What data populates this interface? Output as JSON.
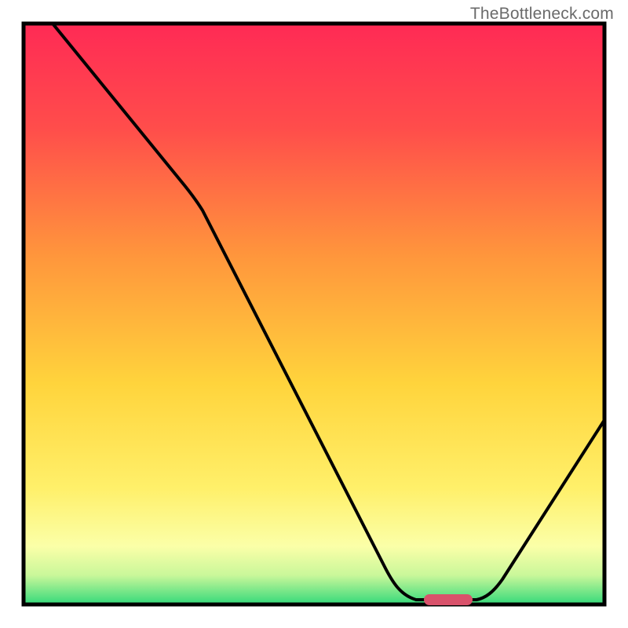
{
  "watermark": "TheBottleneck.com",
  "chart_data": {
    "type": "line",
    "title": "",
    "xlabel": "",
    "ylabel": "",
    "xlim": [
      0,
      100
    ],
    "ylim": [
      0,
      100
    ],
    "grid": false,
    "legend": false,
    "annotations": [],
    "gradient_colors": {
      "top": "#ff2a55",
      "upper_mid": "#ff7a3c",
      "mid": "#ffd93c",
      "lower_mid": "#fff680",
      "bottom": "#34d97a"
    },
    "curve": [
      {
        "x": 5,
        "y": 100
      },
      {
        "x": 27,
        "y": 73
      },
      {
        "x": 62,
        "y": 6
      },
      {
        "x": 68,
        "y": 0.5
      },
      {
        "x": 78,
        "y": 0.5
      },
      {
        "x": 100,
        "y": 32
      }
    ],
    "flat_minimum_range_x": [
      68,
      78
    ],
    "optimum_marker": {
      "x_center": 73,
      "width": 8,
      "color": "#d9526b"
    },
    "axes": {
      "left": true,
      "right": true,
      "top": true,
      "bottom": true,
      "ticks_visible": false,
      "tick_labels_visible": false
    }
  }
}
